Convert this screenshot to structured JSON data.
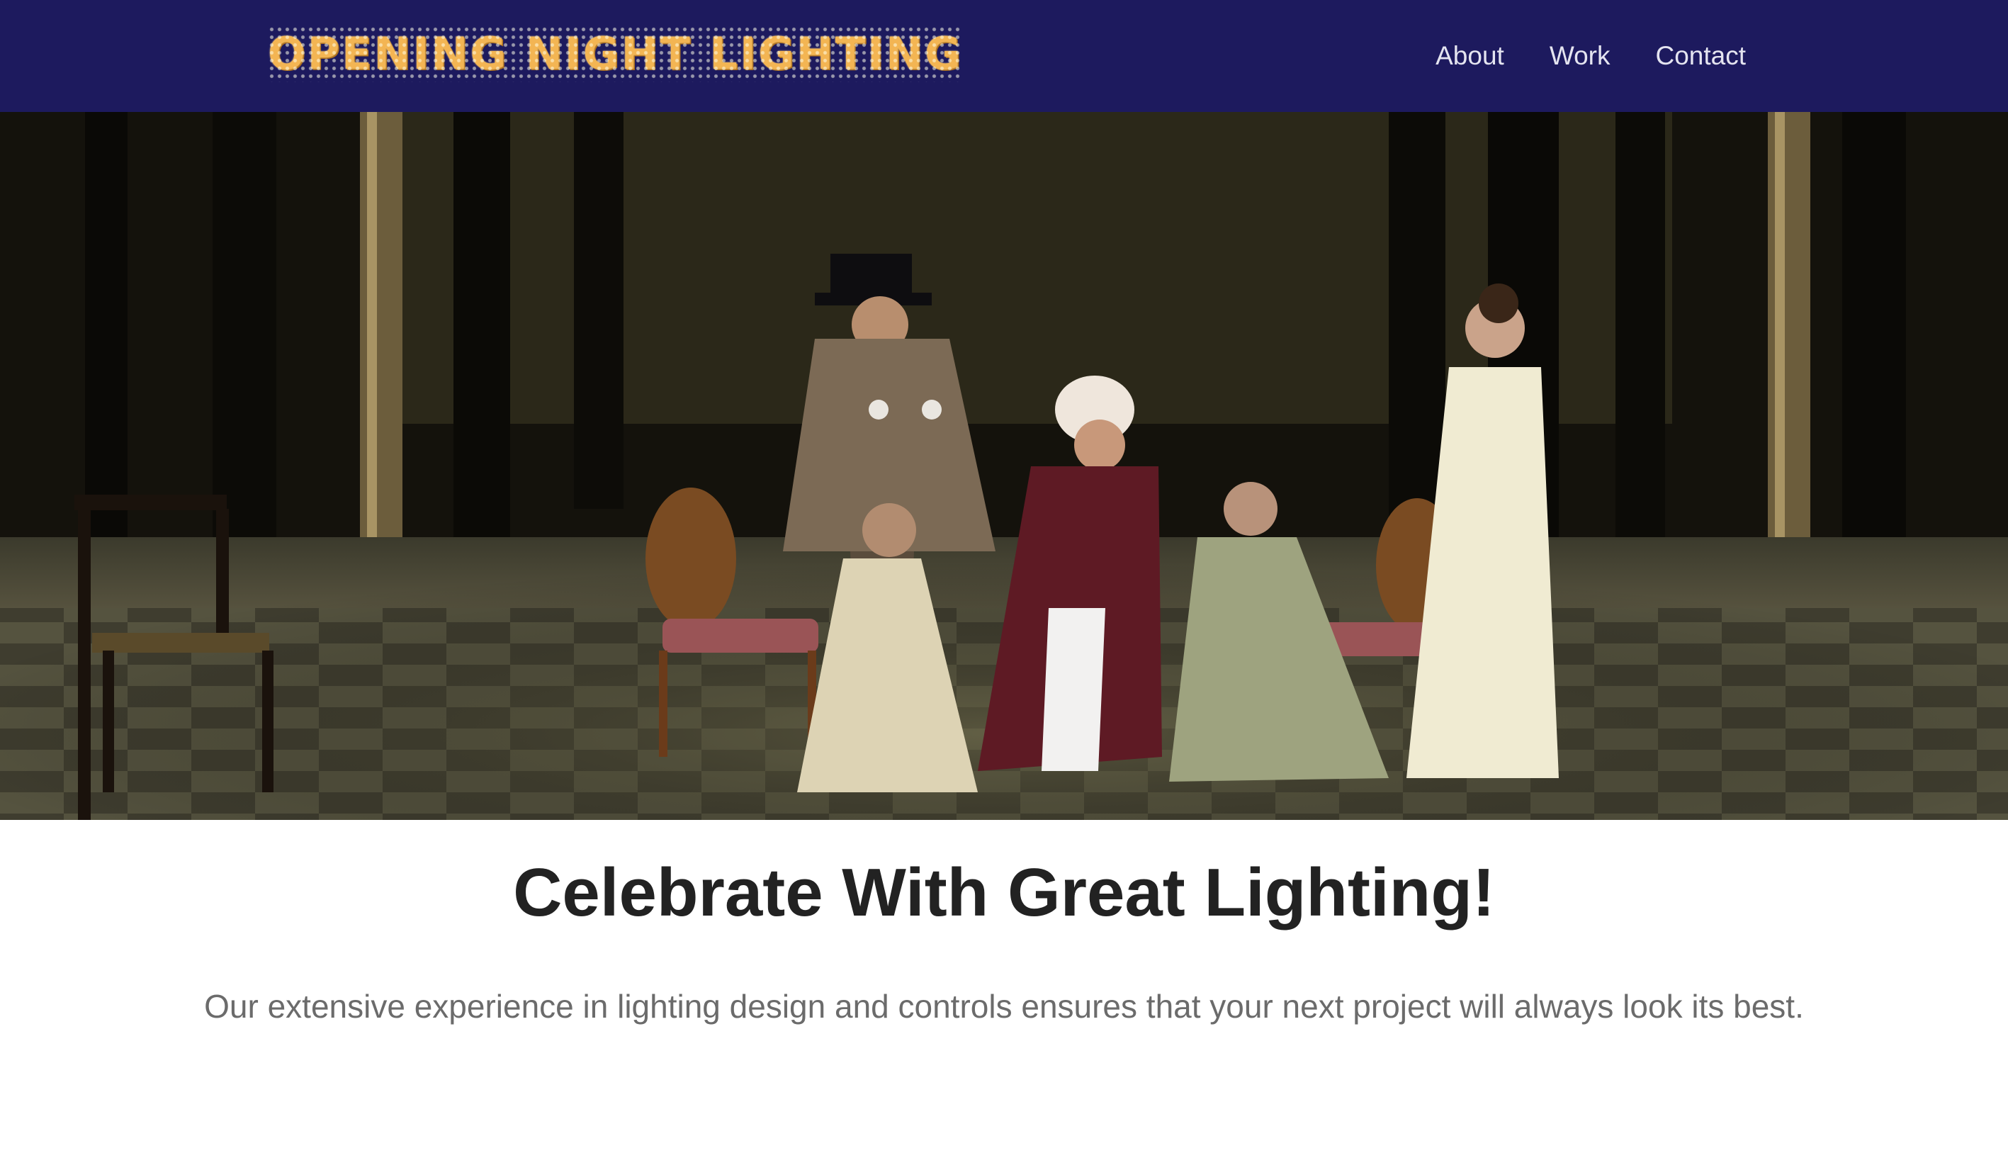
{
  "header": {
    "logo_text": "OPENING NIGHT LIGHTING",
    "nav": [
      {
        "label": "About"
      },
      {
        "label": "Work"
      },
      {
        "label": "Contact"
      }
    ]
  },
  "hero": {
    "image_subject": "theater-stage-period-costume-scene"
  },
  "main": {
    "headline": "Celebrate With Great Lighting!",
    "subtext": "Our extensive experience in lighting design and controls ensures that your next project will always look its best."
  },
  "colors": {
    "header_bg": "#1d1a5e",
    "logo": "#f3b553",
    "nav_text": "#e4e4f0",
    "headline": "#222222",
    "subtext": "#6b6b6b"
  }
}
